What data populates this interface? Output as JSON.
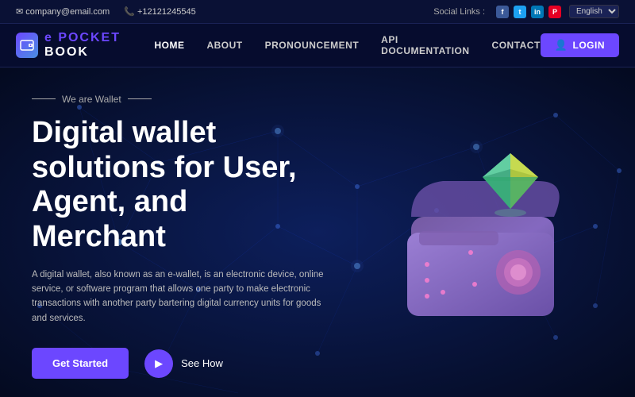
{
  "topbar": {
    "email": "company@email.com",
    "phone": "+12121245545",
    "social_label": "Social Links :",
    "language": "English"
  },
  "navbar": {
    "logo_text_pocket": "POCKET",
    "logo_text_book": " BOOK",
    "nav_items": [
      {
        "label": "HOME",
        "active": true
      },
      {
        "label": "ABOUT",
        "active": false
      },
      {
        "label": "PRONOUNCEMENT",
        "active": false
      },
      {
        "label": "API DOCUMENTATION",
        "active": false
      },
      {
        "label": "CONTACT",
        "active": false
      }
    ],
    "login_label": "LOGIN"
  },
  "hero": {
    "we_are_wallet": "We are Wallet",
    "title_line1": "Digital wallet",
    "title_line2": "solutions for User,",
    "title_line3": "Agent, and Merchant",
    "description": "A digital wallet, also known as an e-wallet, is an electronic device, online service, or software program that allows one party to make electronic transactions with another party bartering digital currency units for goods and services.",
    "cta_primary": "Get Started",
    "cta_secondary": "See How"
  }
}
